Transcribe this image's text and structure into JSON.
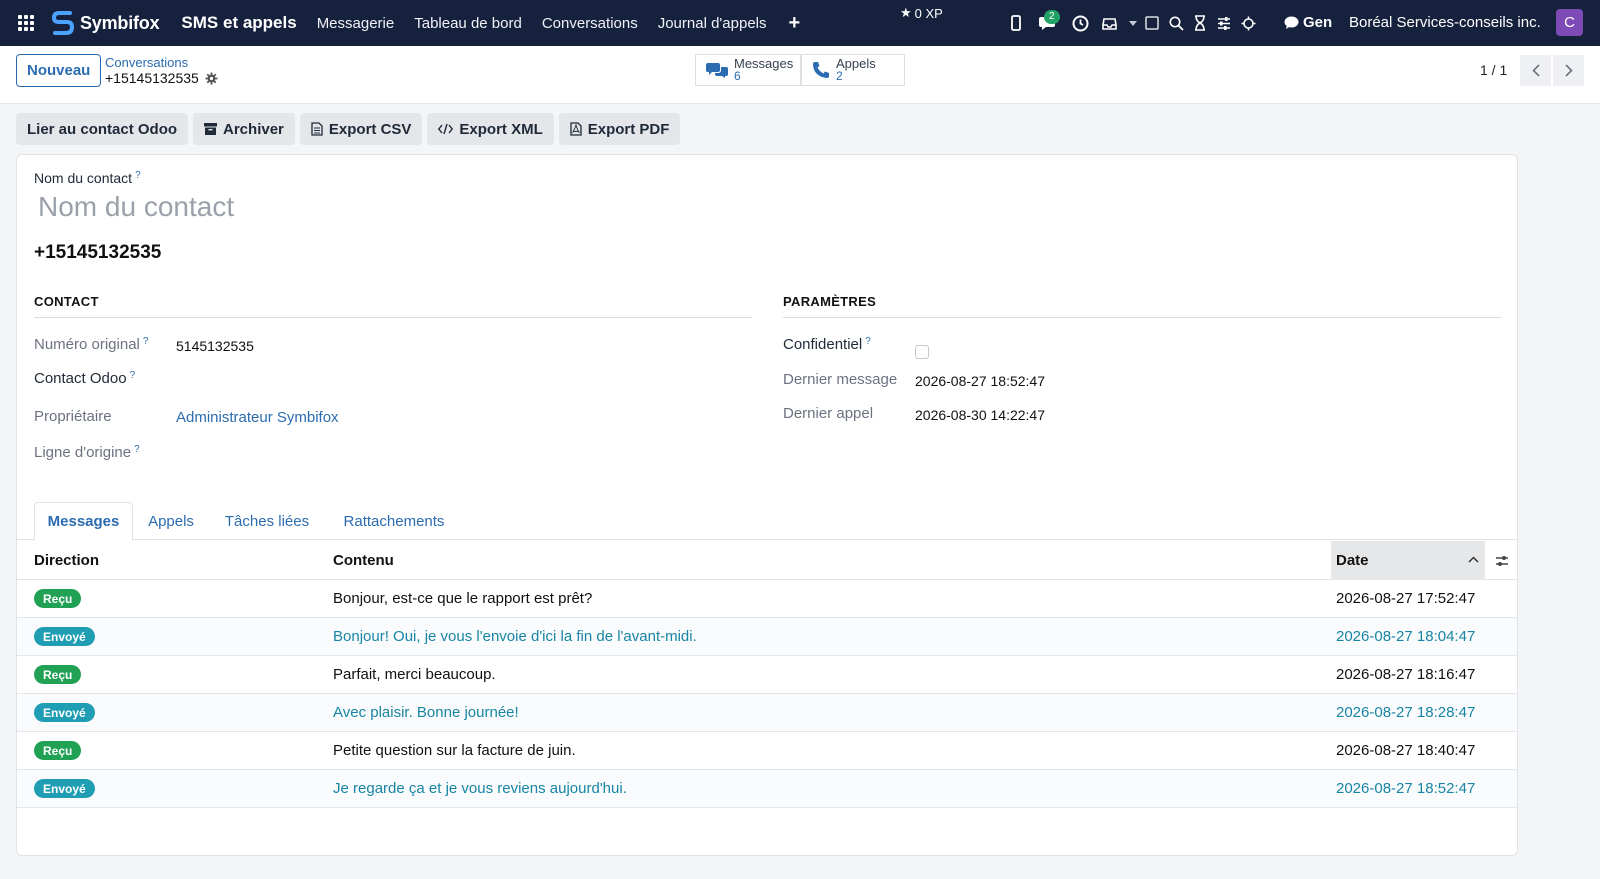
{
  "navbar": {
    "brand": "Symbifox",
    "app_title": "SMS et appels",
    "menu": [
      "Messagerie",
      "Tableau de bord",
      "Conversations",
      "Journal d'appels"
    ],
    "xp": "0 XP",
    "chat_count": "2",
    "gen": "Gen",
    "company": "Boréal Services-conseils inc.",
    "avatar_letter": "C",
    "avatar_color": "#7e4bb6",
    "bar_color": "#16213e"
  },
  "control": {
    "new_button": "Nouveau",
    "breadcrumb_parent": "Conversations",
    "breadcrumb_current": "+15145132535",
    "smart_messages_label": "Messages",
    "smart_messages_value": "6",
    "smart_calls_label": "Appels",
    "smart_calls_value": "2",
    "pager": "1 / 1"
  },
  "actions": [
    "Lier au contact Odoo",
    "Archiver",
    "Export CSV",
    "Export XML",
    "Export PDF"
  ],
  "form": {
    "contact_name_label": "Nom du contact",
    "contact_name_placeholder": "Nom du contact",
    "phone": "+15145132535",
    "contact_section": "CONTACT",
    "params_section": "PARAMÈTRES",
    "original_number_label": "Numéro original",
    "original_number_value": "5145132535",
    "odoo_contact_label": "Contact Odoo",
    "owner_label": "Propriétaire",
    "owner_value": "Administrateur Symbifox",
    "origin_line_label": "Ligne d'origine",
    "confidential_label": "Confidentiel",
    "confidential_checked": false,
    "last_message_label": "Dernier message",
    "last_message_value": "2026-08-27 18:52:47",
    "last_call_label": "Dernier appel",
    "last_call_value": "2026-08-30 14:22:47"
  },
  "tabs": [
    "Messages",
    "Appels",
    "Tâches liées",
    "Rattachements"
  ],
  "table": {
    "headers": {
      "direction": "Direction",
      "content": "Contenu",
      "date": "Date"
    },
    "rows": [
      {
        "direction": "Reçu",
        "content": "Bonjour, est-ce que le rapport est prêt?",
        "date": "2026-08-27 17:52:47"
      },
      {
        "direction": "Envoyé",
        "content": "Bonjour! Oui, je vous l'envoie d'ici la fin de l'avant-midi.",
        "date": "2026-08-27 18:04:47"
      },
      {
        "direction": "Reçu",
        "content": "Parfait, merci beaucoup.",
        "date": "2026-08-27 18:16:47"
      },
      {
        "direction": "Envoyé",
        "content": "Avec plaisir. Bonne journée!",
        "date": "2026-08-27 18:28:47"
      },
      {
        "direction": "Reçu",
        "content": "Petite question sur la facture de juin.",
        "date": "2026-08-27 18:40:47"
      },
      {
        "direction": "Envoyé",
        "content": "Je regarde ça et je vous reviens aujourd'hui.",
        "date": "2026-08-27 18:52:47"
      }
    ]
  }
}
